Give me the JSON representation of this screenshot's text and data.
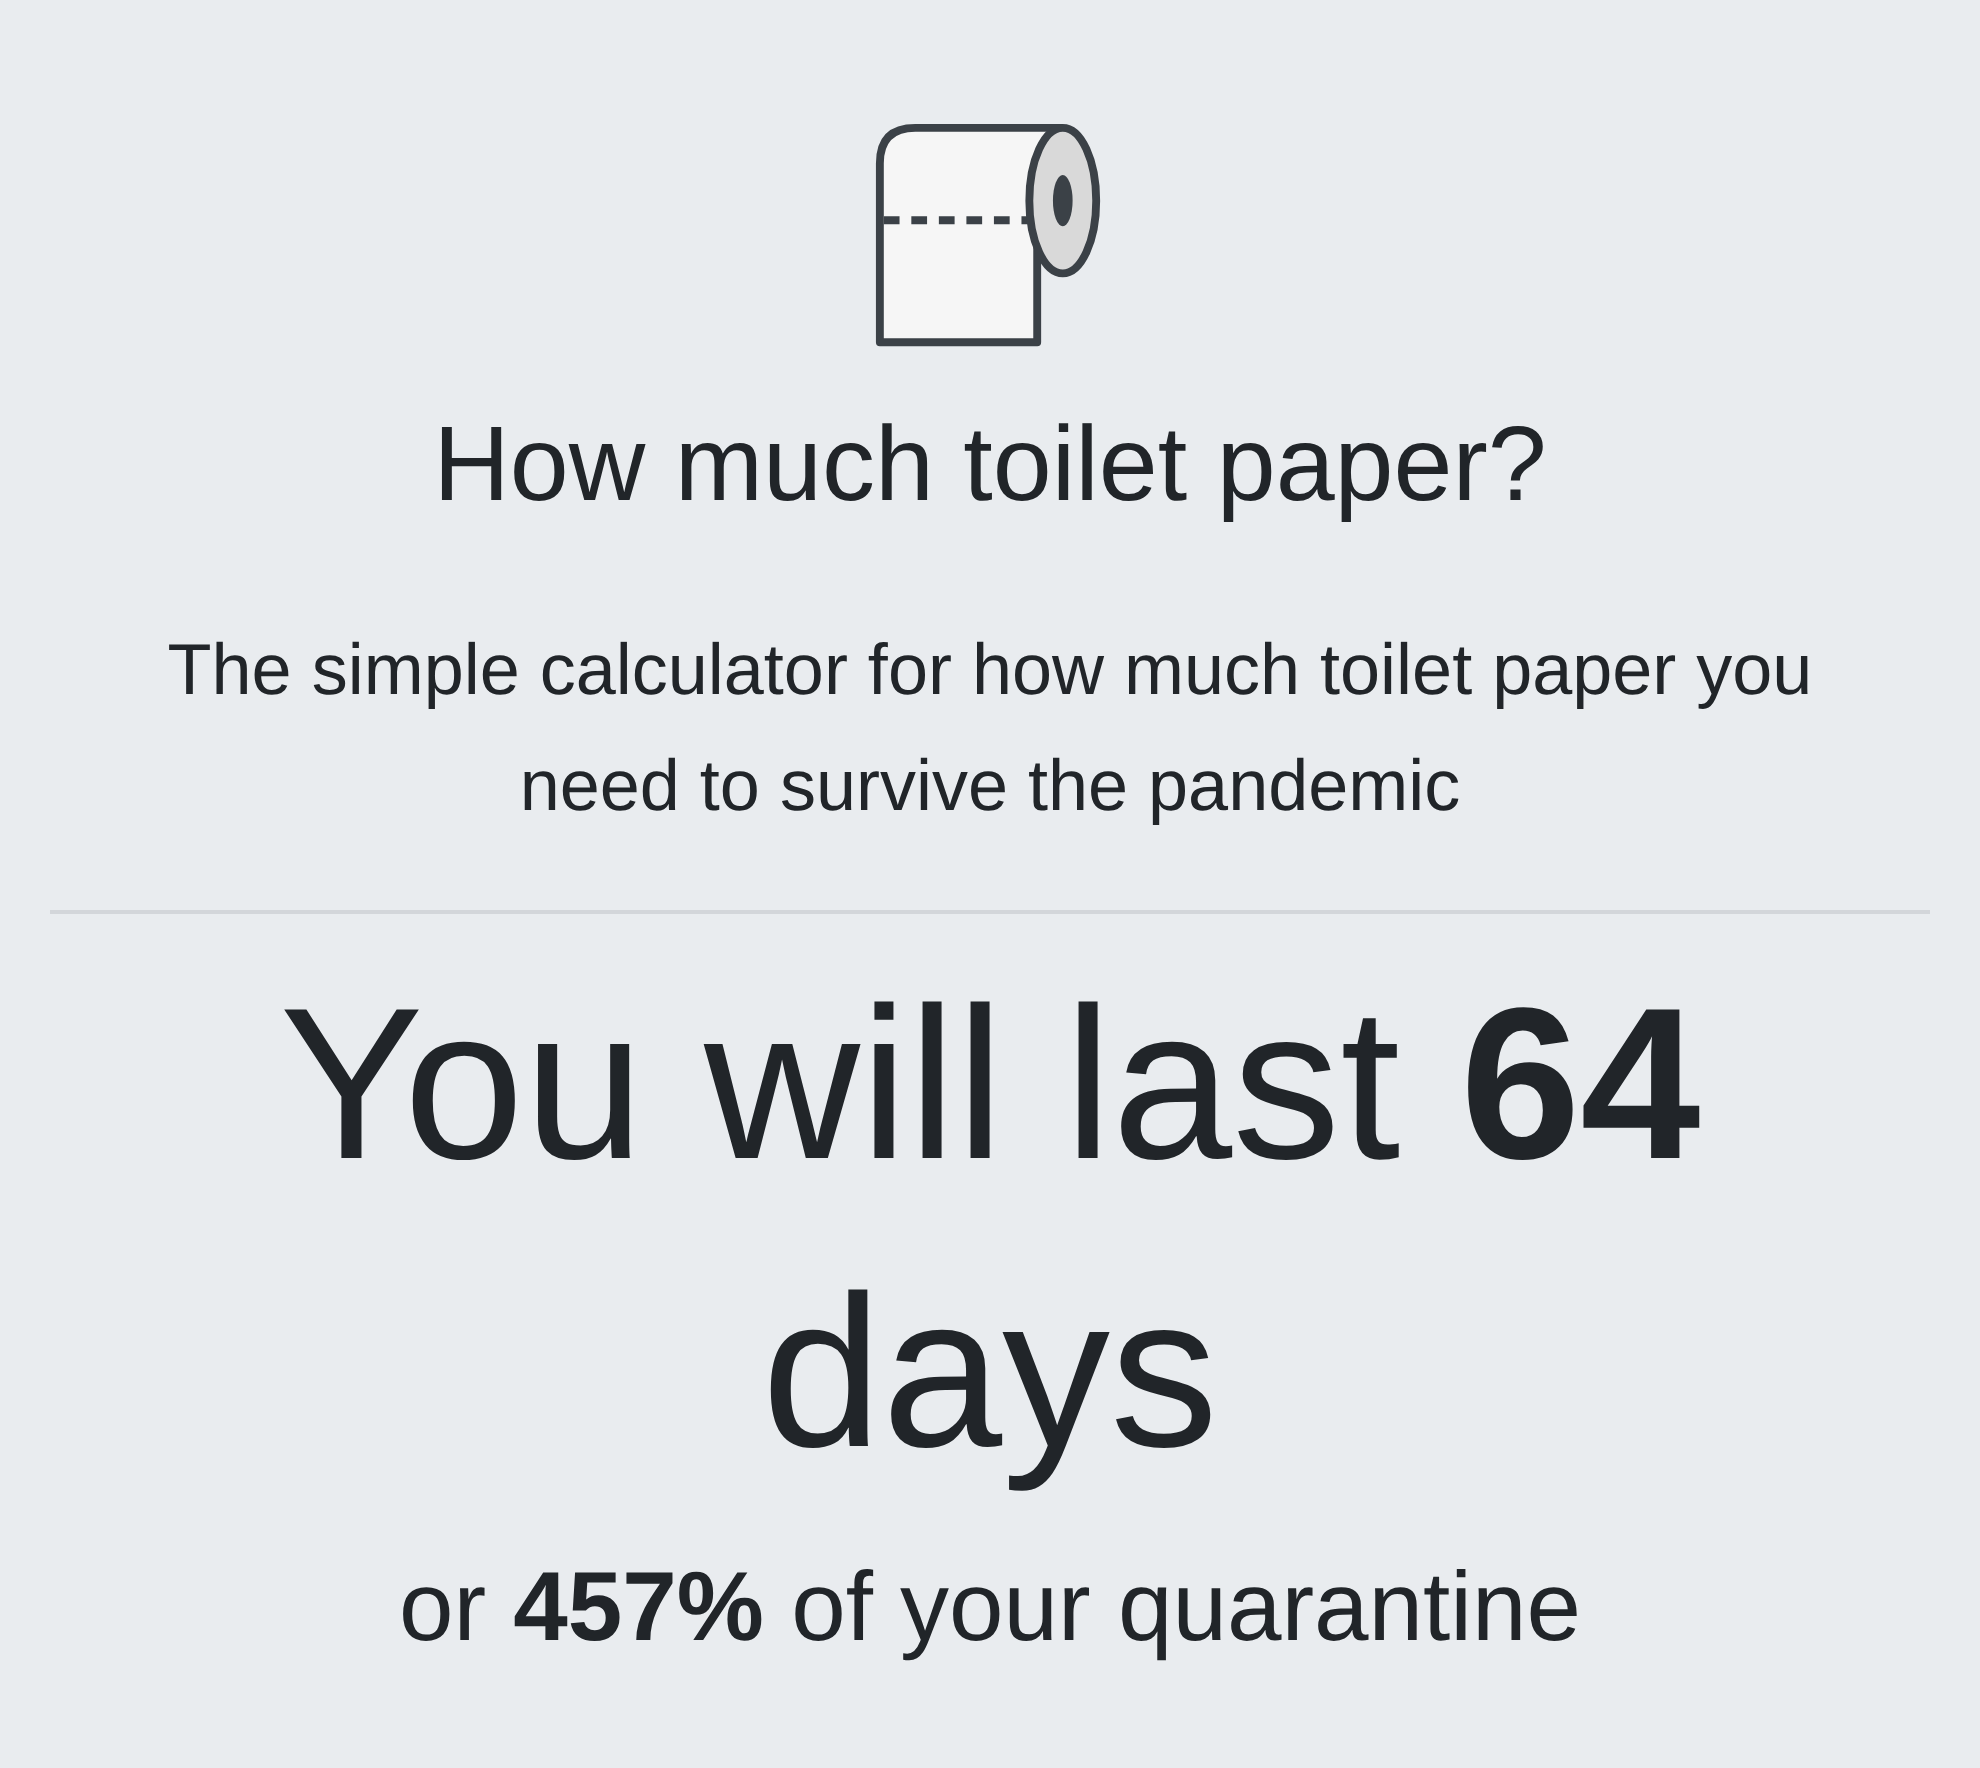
{
  "title": "How much toilet paper?",
  "subtitle": "The simple calculator for how much toilet paper you need to survive the pandemic",
  "result": {
    "headline": "You will last **64** days",
    "detail": "or **457%** of your quarantine"
  }
}
